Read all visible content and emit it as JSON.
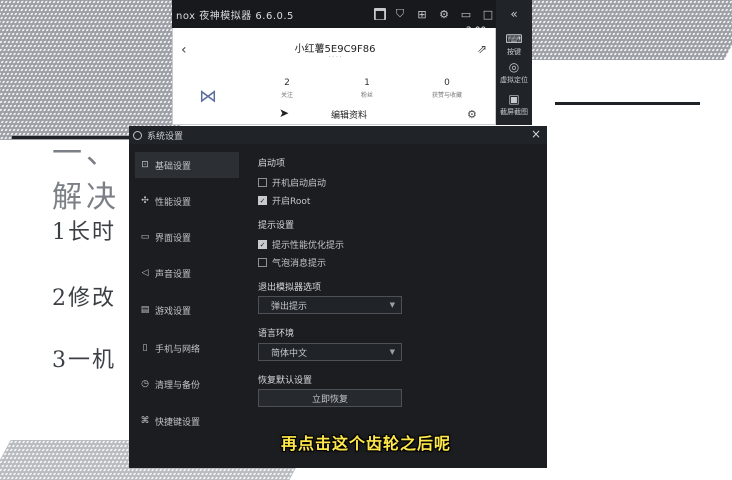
{
  "slide": {
    "heading_line1": "一、",
    "heading_line2": "解决",
    "points": [
      "1长时",
      "2修改",
      "3一机"
    ]
  },
  "emulator": {
    "title": "nox 夜神模拟器 6.6.0.5",
    "status_time": "2:00",
    "sidebar": [
      {
        "icon": "keyboard-icon",
        "glyph": "⌨",
        "label": "按键"
      },
      {
        "icon": "location-icon",
        "glyph": "◎",
        "label": "虚拟定位"
      },
      {
        "icon": "screenshot-icon",
        "glyph": "▣",
        "label": "截屏截图"
      }
    ],
    "app": {
      "profile_name": "小红薯5E9C9F86",
      "profile_sub": "· · · ·",
      "stats": [
        {
          "value": "2",
          "label": "关注"
        },
        {
          "value": "1",
          "label": "粉丝"
        },
        {
          "value": "0",
          "label": "获赞与收藏"
        }
      ],
      "edit_profile_label": "编辑资料"
    }
  },
  "dialog": {
    "title": "系统设置",
    "nav": [
      {
        "icon": "basic-settings-icon",
        "glyph": "⊡",
        "label": "基础设置",
        "active": true
      },
      {
        "icon": "performance-icon",
        "glyph": "✣",
        "label": "性能设置",
        "active": false
      },
      {
        "icon": "interface-icon",
        "glyph": "▭",
        "label": "界面设置",
        "active": false
      },
      {
        "icon": "sound-icon",
        "glyph": "◁",
        "label": "声音设置",
        "active": false
      },
      {
        "icon": "game-icon",
        "glyph": "▤",
        "label": "游戏设置",
        "active": false
      },
      {
        "icon": "phone-icon",
        "glyph": "▯",
        "label": "手机与网络",
        "active": false
      },
      {
        "icon": "backup-icon",
        "glyph": "◷",
        "label": "清理与备份",
        "active": false
      },
      {
        "icon": "shortcut-icon",
        "glyph": "⌘",
        "label": "快捷键设置",
        "active": false
      }
    ],
    "sections": {
      "startup_title": "启动项",
      "boot_autostart": {
        "label": "开机启动启动",
        "checked": false
      },
      "root": {
        "label": "开启Root",
        "checked": true
      },
      "tips_title": "提示设置",
      "perf_tip": {
        "label": "提示性能优化提示",
        "checked": true
      },
      "bubble_tip": {
        "label": "气泡消息提示",
        "checked": false
      },
      "exit_title": "退出模拟器选项",
      "exit_select": "弹出提示",
      "language_title": "语言环境",
      "language_select": "简体中文",
      "restore_title": "恢复默认设置",
      "restore_button": "立即恢复"
    }
  },
  "subtitle": "再点击这个齿轮之后呢"
}
